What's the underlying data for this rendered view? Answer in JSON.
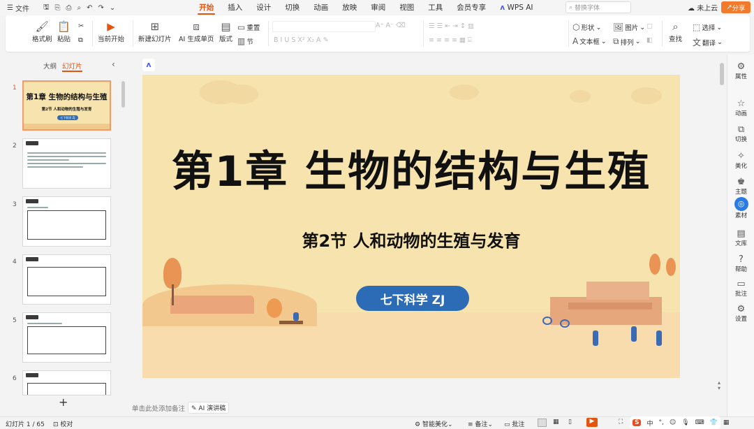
{
  "menubar": {
    "file": "文件",
    "tabs": [
      "开始",
      "插入",
      "设计",
      "切换",
      "动画",
      "放映",
      "审阅",
      "视图",
      "工具",
      "会员专享"
    ],
    "active_tab": "开始",
    "wps_ai": "WPS AI",
    "search_placeholder": "替换字体",
    "cloud": "未上云",
    "share": "分享"
  },
  "ribbon": {
    "format_painter": "格式刷",
    "paste": "粘贴",
    "start_from_current": "当前开始",
    "new_slide": "新建幻灯片",
    "ai_single_page": "AI 生成单页",
    "layout": "版式",
    "reset": "重置",
    "section": "节",
    "shape": "形状",
    "picture": "图片",
    "textbox": "文本框",
    "arrange": "排列",
    "find": "查找",
    "select": "选择",
    "translate": "翻译"
  },
  "left_panel": {
    "tab_outline": "大纲",
    "tab_slides": "幻灯片",
    "slide_numbers": [
      "1",
      "2",
      "3",
      "4",
      "5",
      "6"
    ],
    "add": "+"
  },
  "slide": {
    "title": "第1章  生物的结构与生殖",
    "subtitle": "第2节  人和动物的生殖与发育",
    "badge": "七下科学  ZJ"
  },
  "thumb1": {
    "title": "第1章 生物的结构与生殖",
    "subtitle": "第2节 人和动物的生殖与发育",
    "badge": "七下科学 ZJ"
  },
  "right_sidebar": [
    "属性",
    "动画",
    "切换",
    "美化",
    "主题",
    "素材",
    "文库",
    "帮助",
    "批注",
    "设置"
  ],
  "notes": {
    "placeholder": "单击此处添加备注",
    "ai_speech": "AI 演讲稿"
  },
  "status": {
    "slide_count": "幻灯片 1 / 65",
    "proofread": "校对",
    "smart_beautify": "智能美化",
    "notes": "备注",
    "comments": "批注",
    "zoom_percent": "",
    "ime": "中"
  },
  "colors": {
    "accent": "#e5540d",
    "slide_bg": "#f6e3ad",
    "badge": "#2c6cb7",
    "share": "#f27a2d"
  }
}
